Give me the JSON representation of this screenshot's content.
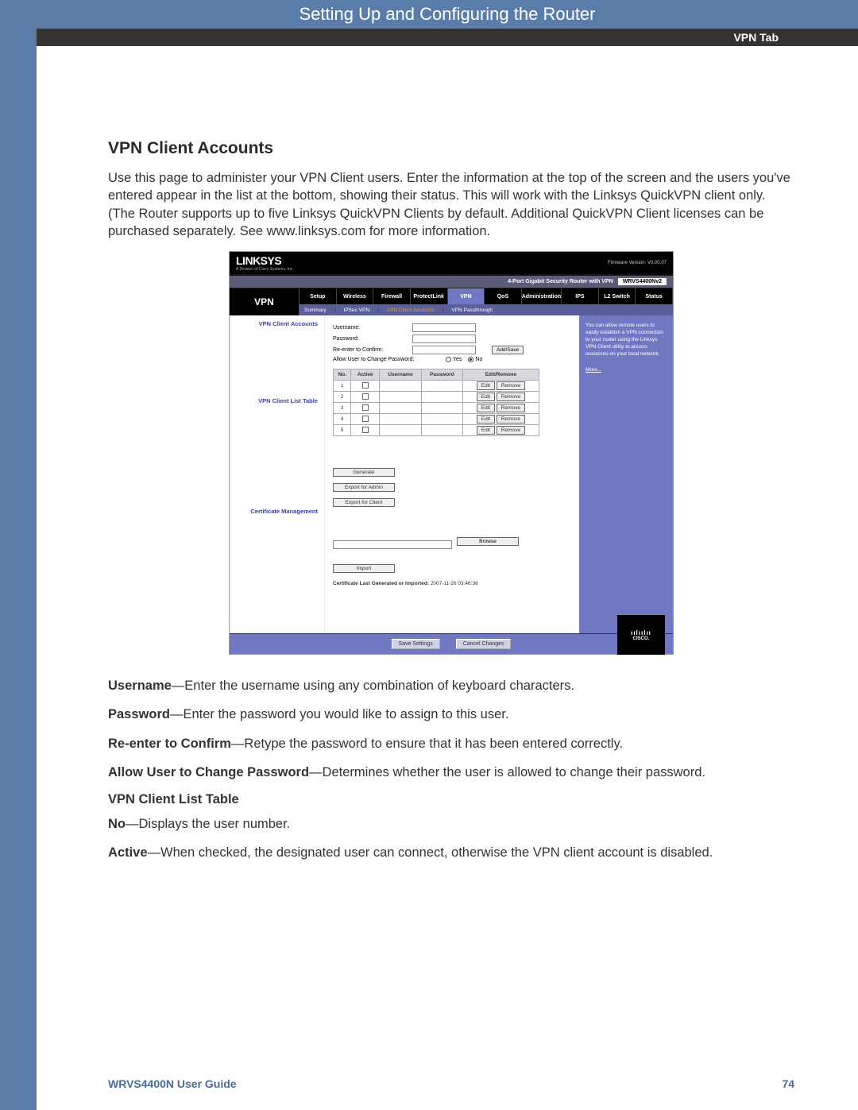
{
  "header": {
    "title": "Setting Up and Configuring the Router",
    "tab_label": "VPN Tab"
  },
  "section_title": "VPN Client Accounts",
  "intro": "Use this page to administer your VPN Client users. Enter the information at the top of the screen and the users you've entered appear in the list at the bottom, showing their status. This will work with the Linksys QuickVPN client only. (The Router supports up to five Linksys QuickVPN Clients by default. Additional QuickVPN Client licenses can be purchased separately. See www.linksys.com for more information.",
  "router": {
    "brand": "LINKSYS",
    "brand_sub": "A Division of Cisco Systems, Inc.",
    "firmware": "Firmware Version: V0.00.07",
    "model_label": "4-Port Gigabit Security Router with VPN",
    "model": "WRVS4400Nv2",
    "active_section": "VPN",
    "tabs": [
      "Setup",
      "Wireless",
      "Firewall",
      "ProtectLink",
      "VPN",
      "QoS",
      "Administration",
      "IPS",
      "L2 Switch",
      "Status"
    ],
    "subtabs": {
      "items": [
        "Summary",
        "IPSec VPN",
        "VPN Client Accounts",
        "VPN Passthrough"
      ],
      "sep": "|"
    },
    "sidebar": {
      "s1": "VPN Client Accounts",
      "s2": "VPN Client List Table",
      "s3": "Certificate Management"
    },
    "form": {
      "username": "Username:",
      "password": "Password:",
      "confirm": "Re-enter to Confirm:",
      "add_save": "Add/Save",
      "allow_label": "Allow User to Change Password:",
      "yes": "Yes",
      "no": "No"
    },
    "table": {
      "headers": [
        "No.",
        "Active",
        "Username",
        "Password",
        "Edit/Remove"
      ],
      "edit": "Edit",
      "remove": "Remove",
      "rows": [
        1,
        2,
        3,
        4,
        5
      ]
    },
    "cert": {
      "generate": "Generate",
      "export_admin": "Export for Admin",
      "export_client": "Export for Client",
      "browse": "Browse",
      "import": "Import",
      "ts_label": "Certificate Last Generated or Imported:",
      "ts": "2007-11-26 03:46:36"
    },
    "help": "You can allow remote users to easily establish a VPN connection to your router using the Linksys VPN Client utility to access resources on your local network.",
    "help_more": "More...",
    "save": "Save Settings",
    "cancel": "Cancel Changes",
    "cisco": {
      "bars": "ıılıılıı",
      "name": "CISCO."
    }
  },
  "desc": {
    "username_b": "Username",
    "username_t": "—Enter the username using any combination of keyboard characters.",
    "password_b": "Password",
    "password_t": "—Enter the password you would like to assign to this user.",
    "confirm_b": "Re-enter to Confirm",
    "confirm_t": "—Retype the password to ensure that it has been entered correctly.",
    "allow_b": "Allow User to Change Password",
    "allow_t": "—Determines whether the user is allowed to change their password.",
    "table_h": "VPN Client List Table",
    "no_b": "No",
    "no_t": "—Displays the user number.",
    "active_b": "Active",
    "active_t": "—When checked, the designated user can connect, otherwise the VPN client account is disabled."
  },
  "footer": {
    "guide": "WRVS4400N User Guide",
    "page": "74"
  }
}
